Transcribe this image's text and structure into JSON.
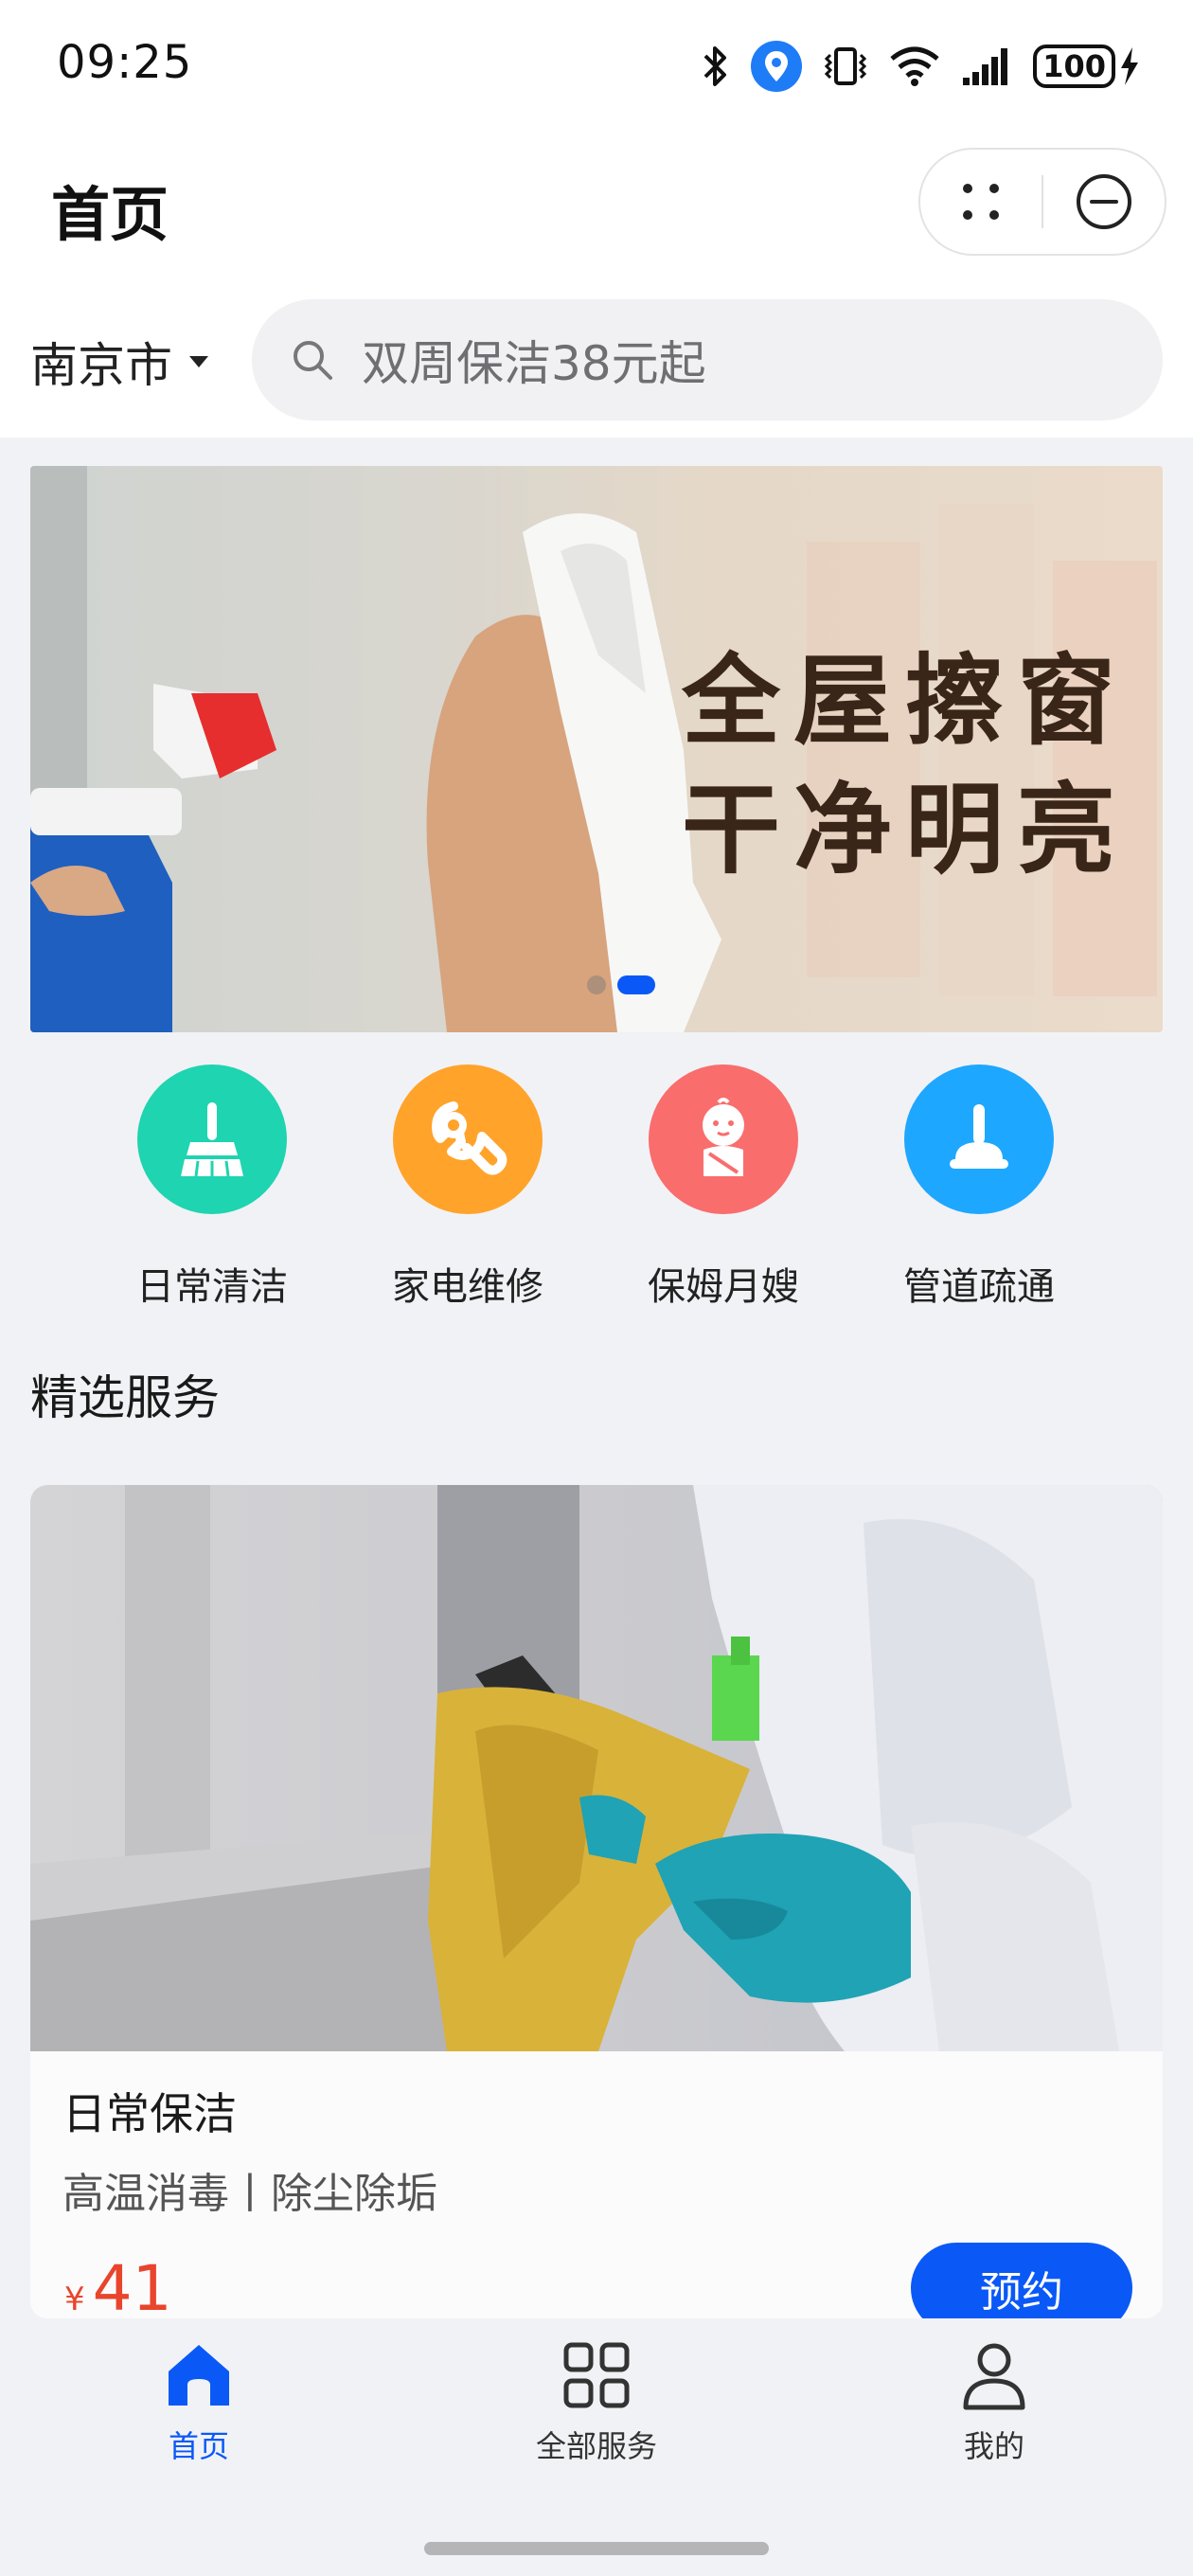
{
  "status_bar": {
    "time": "09:25",
    "battery": "100",
    "icons": [
      "bluetooth-icon",
      "location-icon",
      "vibrate-icon",
      "wifi-icon",
      "signal-icon",
      "battery-icon",
      "charging-icon"
    ]
  },
  "header": {
    "title": "首页",
    "capsule_icons": [
      "more-dots-icon",
      "close-circle-icon"
    ]
  },
  "search_row": {
    "city": "南京市",
    "placeholder": "双周保洁38元起"
  },
  "banner": {
    "line1": "全屋擦窗",
    "line2": "干净明亮",
    "slide_count": 2,
    "active_slide": 2
  },
  "categories": [
    {
      "label": "日常清洁",
      "icon": "broom-icon",
      "color": "#1fd4b0"
    },
    {
      "label": "家电维修",
      "icon": "wrench-icon",
      "color": "#ffa32b"
    },
    {
      "label": "保姆月嫂",
      "icon": "baby-icon",
      "color": "#f96d6d"
    },
    {
      "label": "管道疏通",
      "icon": "plunger-icon",
      "color": "#1ea7ff"
    }
  ],
  "section": {
    "title": "精选服务"
  },
  "service_card": {
    "title": "日常保洁",
    "desc": "高温消毒丨除尘除垢",
    "currency": "¥",
    "price": "41",
    "button": "预约"
  },
  "tab_bar": {
    "items": [
      {
        "label": "首页",
        "icon": "home-icon",
        "active": true
      },
      {
        "label": "全部服务",
        "icon": "grid-icon",
        "active": false
      },
      {
        "label": "我的",
        "icon": "user-icon",
        "active": false
      }
    ]
  },
  "colors": {
    "accent": "#0a59f7",
    "price": "#e8452c",
    "background": "#f1f2f5"
  }
}
